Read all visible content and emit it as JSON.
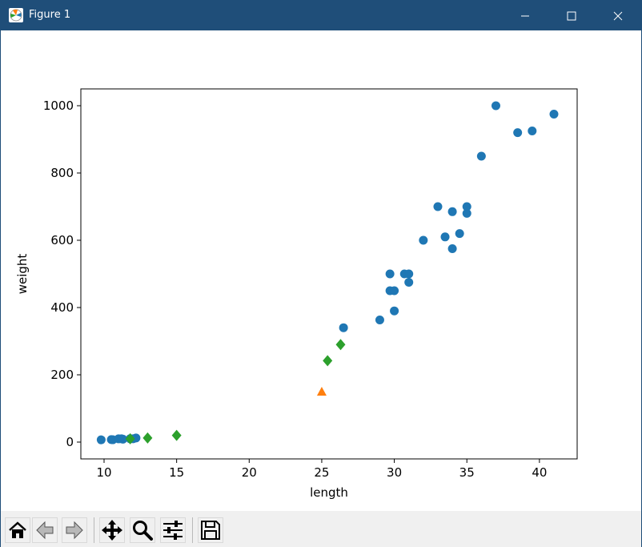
{
  "window": {
    "title": "Figure 1",
    "controls": {
      "minimize_icon": "minimize-icon",
      "maximize_icon": "maximize-icon",
      "close_icon": "close-icon"
    }
  },
  "toolbar": {
    "buttons": [
      {
        "name": "home-button",
        "icon": "home-icon"
      },
      {
        "name": "back-button",
        "icon": "back-arrow-icon"
      },
      {
        "name": "forward-button",
        "icon": "forward-arrow-icon"
      },
      {
        "name": "pan-button",
        "icon": "move-icon"
      },
      {
        "name": "zoom-button",
        "icon": "magnifier-icon"
      },
      {
        "name": "configure-subplots-button",
        "icon": "sliders-icon"
      },
      {
        "name": "save-button",
        "icon": "floppy-disk-icon"
      }
    ]
  },
  "chart_data": {
    "type": "scatter",
    "title": "",
    "xlabel": "length",
    "ylabel": "weight",
    "xlim": [
      8.4,
      42.6
    ],
    "ylim": [
      -50,
      1050
    ],
    "xticks": [
      10,
      15,
      20,
      25,
      30,
      35,
      40
    ],
    "yticks": [
      0,
      200,
      400,
      600,
      800,
      1000
    ],
    "grid": false,
    "series": [
      {
        "color": "#1f77b4",
        "marker": "circle",
        "points": [
          [
            9.8,
            6.7
          ],
          [
            10.5,
            7.5
          ],
          [
            10.6,
            7.0
          ],
          [
            11.0,
            9.7
          ],
          [
            11.2,
            9.8
          ],
          [
            11.3,
            8.7
          ],
          [
            11.8,
            10.0
          ],
          [
            11.8,
            9.9
          ],
          [
            12.0,
            9.8
          ],
          [
            12.2,
            12.2
          ],
          [
            26.5,
            340
          ],
          [
            29.0,
            363
          ],
          [
            29.7,
            450
          ],
          [
            29.7,
            500
          ],
          [
            30.0,
            450
          ],
          [
            30.0,
            390
          ],
          [
            30.7,
            500
          ],
          [
            31.0,
            475
          ],
          [
            31.0,
            500
          ],
          [
            32.0,
            600
          ],
          [
            33.0,
            700
          ],
          [
            33.5,
            610
          ],
          [
            34.0,
            685
          ],
          [
            34.0,
            575
          ],
          [
            34.5,
            620
          ],
          [
            35.0,
            680
          ],
          [
            35.0,
            700
          ],
          [
            36.0,
            850
          ],
          [
            37.0,
            1000
          ],
          [
            38.5,
            920
          ],
          [
            39.5,
            925
          ],
          [
            41.0,
            975
          ]
        ]
      },
      {
        "color": "#ff7f0e",
        "marker": "triangle",
        "points": [
          [
            25,
            150
          ]
        ]
      },
      {
        "color": "#2ca02c",
        "marker": "diamond",
        "points": [
          [
            11.8,
            9.9
          ],
          [
            13.0,
            12.2
          ],
          [
            15.0,
            19.9
          ],
          [
            25.4,
            242
          ],
          [
            26.3,
            290
          ]
        ]
      }
    ]
  }
}
